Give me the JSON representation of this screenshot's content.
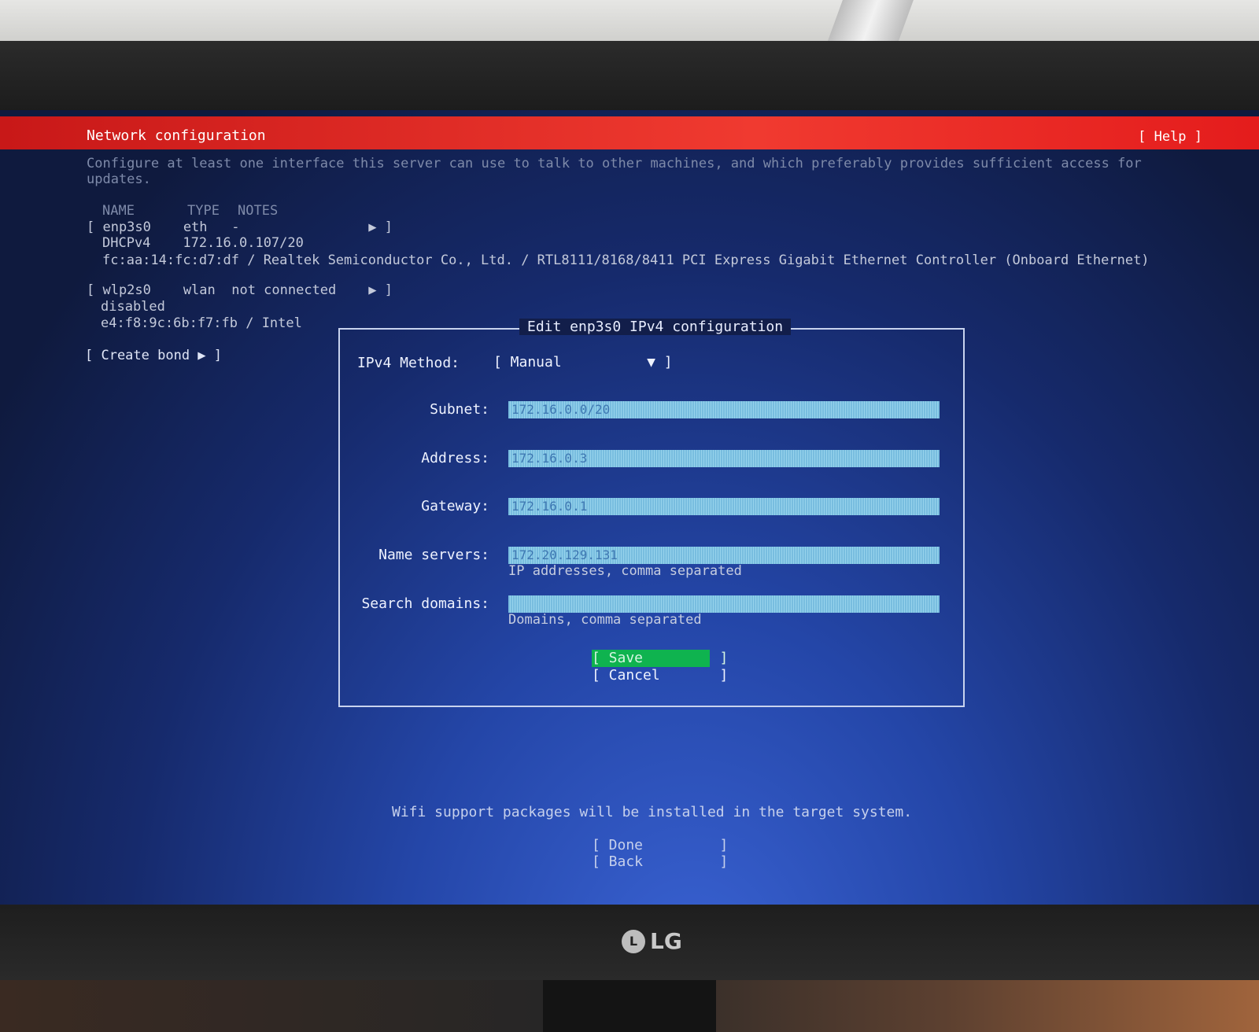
{
  "header": {
    "title": "Network configuration",
    "help": "[ Help ]"
  },
  "intro": {
    "line1": "Configure at least one interface this server can use to talk to other machines, and which preferably provides sufficient access for",
    "line2": "updates."
  },
  "table": {
    "col_name": "NAME",
    "col_type": "TYPE",
    "col_notes": "NOTES"
  },
  "interfaces": [
    {
      "row": "[ enp3s0    eth   -                ▶ ]",
      "status": "DHCPv4    172.16.0.107/20",
      "detail": "fc:aa:14:fc:d7:df / Realtek Semiconductor Co., Ltd. / RTL8111/8168/8411 PCI Express Gigabit Ethernet Controller (Onboard Ethernet)"
    },
    {
      "row": "[ wlp2s0    wlan  not connected    ▶ ]",
      "status": "disabled",
      "detail": "e4:f8:9c:6b:f7:fb / Intel"
    }
  ],
  "create_bond": "[ Create bond ▶ ]",
  "dialog": {
    "title": "Edit enp3s0 IPv4 configuration",
    "method_label": "IPv4 Method:",
    "method_value": "[ Manual          ▼ ]",
    "subnet_label": "Subnet:",
    "subnet_value": "172.16.0.0/20",
    "address_label": "Address:",
    "address_value": "172.16.0.3",
    "gateway_label": "Gateway:",
    "gateway_value": "172.16.0.1",
    "nameservers_label": "Name servers:",
    "nameservers_value": "172.20.129.131",
    "nameservers_hint": "IP addresses, comma separated",
    "search_label": "Search domains:",
    "search_value": "",
    "search_hint": "Domains, comma separated",
    "save": "[ Save         ]",
    "cancel": "[ Cancel       ]"
  },
  "footer": {
    "wifi_note": "Wifi support packages will be installed in the target system.",
    "done": "[ Done         ]",
    "back": "[ Back         ]"
  },
  "monitor": {
    "brand": "LG"
  }
}
